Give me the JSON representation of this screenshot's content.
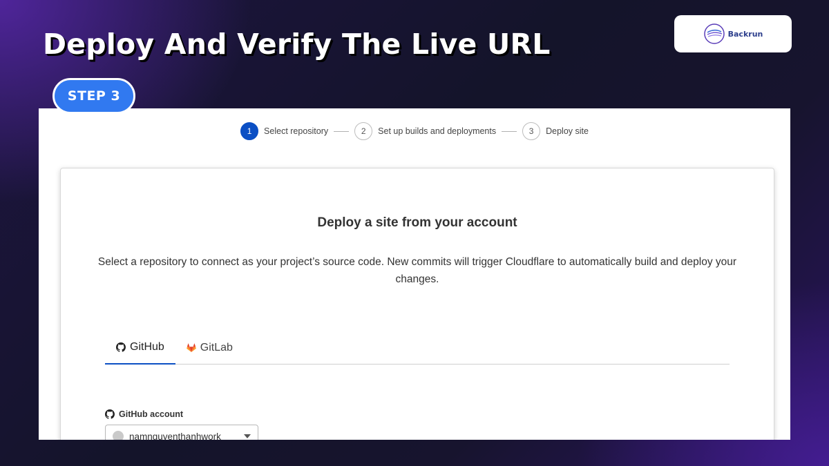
{
  "headline": "Deploy And Verify The Live URL",
  "logo": {
    "text": "Backrun",
    "icon": "backrun-logo-icon"
  },
  "step_badge": "STEP 3",
  "stepper": {
    "steps": [
      {
        "number": "1",
        "label": "Select repository",
        "active": true
      },
      {
        "number": "2",
        "label": "Set up builds and deployments",
        "active": false
      },
      {
        "number": "3",
        "label": "Deploy site",
        "active": false
      }
    ],
    "active_color": "#0b4fc4"
  },
  "card": {
    "title": "Deploy a site from your account",
    "description": "Select a repository to connect as your project’s source code. New commits will trigger Cloudflare to automatically build and deploy your changes.",
    "tabs": [
      {
        "label": "GitHub",
        "icon": "github-icon",
        "active": true
      },
      {
        "label": "GitLab",
        "icon": "gitlab-icon",
        "active": false
      }
    ],
    "account_label": "GitHub account",
    "account_value": "namnguyenthanhwork"
  },
  "colors": {
    "step_pill": "#3179f0",
    "accent": "#0b4fc4"
  }
}
